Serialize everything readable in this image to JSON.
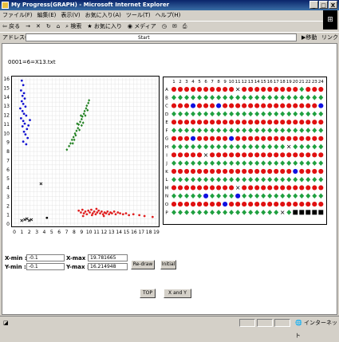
{
  "window": {
    "title": "My Progress(GRAPH) - Microsoft Internet Explorer",
    "controls": [
      "_",
      "□",
      "X"
    ]
  },
  "menu": [
    "ファイル(F)",
    "編集(E)",
    "表示(V)",
    "お気に入り(A)",
    "ツール(T)",
    "ヘルプ(H)"
  ],
  "toolbar": {
    "back": "戻る",
    "forward": "→",
    "search": "検索",
    "favorites": "お気に入り",
    "media": "メディア"
  },
  "address": {
    "label": "アドレス(D)",
    "value": "Start",
    "go": "移動",
    "links": "リンク"
  },
  "file_label": "0001=6=X13.txt",
  "chart_data": {
    "type": "scatter",
    "xlim": [
      0,
      19
    ],
    "ylim": [
      0,
      16
    ],
    "x_ticks": [
      0,
      1,
      2,
      3,
      4,
      5,
      6,
      7,
      8,
      9,
      10,
      11,
      12,
      13,
      14,
      15,
      16,
      17,
      18,
      19
    ],
    "y_ticks": [
      0,
      1,
      2,
      3,
      4,
      5,
      6,
      7,
      8,
      9,
      10,
      11,
      12,
      13,
      14,
      15,
      16
    ],
    "grid": true,
    "series": [
      {
        "color": "#1010d0",
        "marker": "dot",
        "points": [
          [
            0.9,
            15.9
          ],
          [
            1.1,
            15.4
          ],
          [
            0.8,
            14.8
          ],
          [
            1.2,
            14.5
          ],
          [
            1.0,
            14.2
          ],
          [
            1.3,
            13.9
          ],
          [
            0.9,
            13.6
          ],
          [
            1.1,
            13.3
          ],
          [
            1.4,
            13.0
          ],
          [
            0.7,
            12.8
          ],
          [
            1.0,
            12.5
          ],
          [
            1.2,
            12.2
          ],
          [
            1.5,
            12.0
          ],
          [
            0.8,
            11.7
          ],
          [
            1.1,
            11.4
          ],
          [
            1.3,
            11.1
          ],
          [
            1.0,
            10.8
          ],
          [
            1.6,
            10.5
          ],
          [
            1.2,
            10.2
          ],
          [
            1.4,
            9.9
          ],
          [
            1.7,
            9.5
          ],
          [
            1.1,
            9.1
          ],
          [
            1.5,
            8.8
          ],
          [
            2.0,
            11.5
          ],
          [
            1.8,
            10.9
          ]
        ]
      },
      {
        "color": "#208020",
        "marker": "diamond",
        "points": [
          [
            7.0,
            8.2
          ],
          [
            7.3,
            8.6
          ],
          [
            7.5,
            8.9
          ],
          [
            7.7,
            9.3
          ],
          [
            7.9,
            9.6
          ],
          [
            8.1,
            10.0
          ],
          [
            8.3,
            10.3
          ],
          [
            8.5,
            10.6
          ],
          [
            8.6,
            11.0
          ],
          [
            8.8,
            11.3
          ],
          [
            9.0,
            11.6
          ],
          [
            9.1,
            11.9
          ],
          [
            9.3,
            12.2
          ],
          [
            9.4,
            12.5
          ],
          [
            9.6,
            12.8
          ],
          [
            9.7,
            13.1
          ],
          [
            9.9,
            13.4
          ],
          [
            8.2,
            9.8
          ],
          [
            8.7,
            10.4
          ],
          [
            9.2,
            11.2
          ],
          [
            8.4,
            11.1
          ],
          [
            9.5,
            12.0
          ],
          [
            7.8,
            8.9
          ],
          [
            9.8,
            12.6
          ],
          [
            8.9,
            12.0
          ],
          [
            10.0,
            13.7
          ],
          [
            8.0,
            9.3
          ],
          [
            9.0,
            10.9
          ]
        ]
      },
      {
        "color": "#e02020",
        "marker": "dot",
        "points": [
          [
            8.6,
            1.4
          ],
          [
            8.9,
            1.2
          ],
          [
            9.1,
            1.5
          ],
          [
            9.3,
            1.1
          ],
          [
            9.5,
            1.3
          ],
          [
            9.7,
            1.0
          ],
          [
            9.9,
            1.4
          ],
          [
            10.1,
            1.2
          ],
          [
            10.3,
            1.5
          ],
          [
            10.5,
            1.1
          ],
          [
            10.7,
            1.3
          ],
          [
            10.9,
            1.0
          ],
          [
            11.1,
            1.2
          ],
          [
            11.3,
            1.4
          ],
          [
            11.5,
            1.1
          ],
          [
            11.7,
            1.3
          ],
          [
            11.9,
            1.0
          ],
          [
            12.1,
            1.2
          ],
          [
            12.3,
            1.1
          ],
          [
            12.5,
            1.3
          ],
          [
            12.7,
            1.0
          ],
          [
            12.9,
            1.2
          ],
          [
            13.1,
            1.1
          ],
          [
            13.4,
            1.3
          ],
          [
            13.6,
            1.0
          ],
          [
            13.9,
            1.2
          ],
          [
            14.2,
            1.1
          ],
          [
            14.6,
            1.0
          ],
          [
            15.0,
            1.1
          ],
          [
            15.4,
            0.9
          ],
          [
            16.0,
            1.0
          ],
          [
            16.8,
            0.9
          ],
          [
            17.5,
            0.8
          ],
          [
            18.6,
            0.7
          ],
          [
            9.2,
            0.8
          ],
          [
            10.4,
            0.9
          ],
          [
            11.0,
            1.6
          ],
          [
            12.0,
            0.8
          ]
        ]
      },
      {
        "color": "#000000",
        "marker": "x",
        "points": [
          [
            3.5,
            4.4
          ],
          [
            0.9,
            0.3
          ],
          [
            1.3,
            0.4
          ],
          [
            1.9,
            0.3
          ],
          [
            2.2,
            0.4
          ],
          [
            1.6,
            0.5
          ]
        ]
      },
      {
        "color": "#000000",
        "marker": "dot",
        "points": [
          [
            4.3,
            0.6
          ]
        ]
      }
    ]
  },
  "grid_panel": {
    "columns": [
      1,
      2,
      3,
      4,
      5,
      6,
      7,
      8,
      9,
      10,
      11,
      12,
      13,
      14,
      15,
      16,
      17,
      18,
      19,
      20,
      21,
      22,
      23,
      24
    ],
    "rows": [
      {
        "label": "A",
        "cells": "RRRRRRRRRRXRRRRRRRRRGRRR"
      },
      {
        "label": "B",
        "cells": "GGGGGGGGGGGGGGGGGGGGGGGG"
      },
      {
        "label": "C",
        "cells": "RRRBRRRBRRRRRRRRRRRRRRRB"
      },
      {
        "label": "D",
        "cells": "GGGGGGGGGGGGGGGGGGGGGGGG"
      },
      {
        "label": "E",
        "cells": "RRRRRRRRRRRRRRRRRRRRRRRR"
      },
      {
        "label": "F",
        "cells": "GGGGGGGGGGGGGGGGGGGGGGGG"
      },
      {
        "label": "G",
        "cells": "RRRBRRRRRBRRRRRRRRRRRRRR"
      },
      {
        "label": "H",
        "cells": "GGGGGGGGGGGGGGGGGGXGGGGG"
      },
      {
        "label": "I",
        "cells": "RRRRRXRRRRRRRRRRRRRRRRRR"
      },
      {
        "label": "J",
        "cells": "GGGGGGGGGGGGGGGGGGGGGGGG"
      },
      {
        "label": "K",
        "cells": "RRRRRRRRRRRRRRRRRRRBRRRR"
      },
      {
        "label": "L",
        "cells": "GGGGGGGGGGGGGGGGGGGGGGGG"
      },
      {
        "label": "M",
        "cells": "RRRRRRRRRRXRRRRRRRRRRRRR"
      },
      {
        "label": "N",
        "cells": "GGGGGBGGGGBGGGGGGGGGGGGG"
      },
      {
        "label": "O",
        "cells": "RRRRRRRRBRRRRRRRRRRRRRRR"
      },
      {
        "label": "P",
        "cells": "GGGGGGGGGGGGGGGGGXGSSSSS"
      }
    ]
  },
  "controls": {
    "xmin_label": "X-min :",
    "xmin_value": "-0.1",
    "ymin_label": "Y-min :",
    "ymin_value": "-0.1",
    "xmax_label": "X-max :",
    "xmax_value": "19.781665",
    "ymax_label": "Y-max :",
    "ymax_value": "16.214948",
    "redraw": "Re-draw",
    "initial": "Initial",
    "top": "TOP",
    "x_and_y": "X and Y"
  },
  "status": {
    "zone": "インターネット"
  }
}
